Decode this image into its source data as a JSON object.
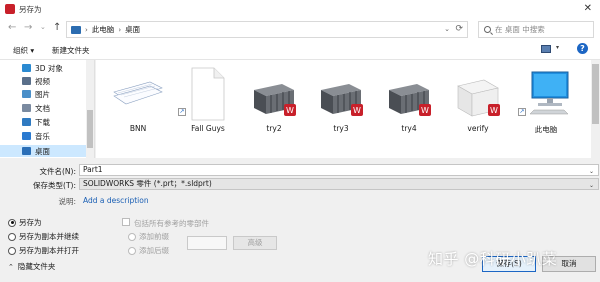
{
  "window": {
    "title": "另存为",
    "close_glyph": "✕"
  },
  "nav": {
    "back": "←",
    "forward": "→",
    "recent": "⌄",
    "up": "↑",
    "breadcrumbs": [
      "此电脑",
      "桌面"
    ],
    "separator": "›",
    "addr_dropdown": "⌄",
    "refresh": "⟳",
    "search_placeholder": "在 桌面 中搜索"
  },
  "toolbar": {
    "organize": "组织 ▾",
    "new_folder": "新建文件夹",
    "view_chevron": "▾",
    "help": "?"
  },
  "sidebar": {
    "items": [
      {
        "label": "3D 对象",
        "icon": "3d-objects-icon",
        "color": "#2b8ad1"
      },
      {
        "label": "视频",
        "icon": "videos-icon",
        "color": "#5a6f8a"
      },
      {
        "label": "图片",
        "icon": "pictures-icon",
        "color": "#4a8fc9"
      },
      {
        "label": "文档",
        "icon": "documents-icon",
        "color": "#7a8aa0"
      },
      {
        "label": "下载",
        "icon": "downloads-icon",
        "color": "#2f7ac1"
      },
      {
        "label": "音乐",
        "icon": "music-icon",
        "color": "#2a7ad0"
      },
      {
        "label": "桌面",
        "icon": "desktop-icon",
        "color": "#2a6fb8"
      }
    ],
    "selected_index": 6
  },
  "files": [
    {
      "label": "BNN",
      "icon": "document-stack-icon"
    },
    {
      "label": "Fall Guys",
      "icon": "blank-file-shortcut-icon"
    },
    {
      "label": "try2",
      "icon": "solidworks-assembly-icon"
    },
    {
      "label": "try3",
      "icon": "solidworks-assembly-icon"
    },
    {
      "label": "try4",
      "icon": "solidworks-assembly-icon"
    },
    {
      "label": "verify",
      "icon": "solidworks-part-icon"
    },
    {
      "label": "此电脑",
      "icon": "this-pc-shortcut-icon"
    }
  ],
  "form": {
    "filename_label": "文件名(N):",
    "filename_value": "Part1",
    "filetype_label": "保存类型(T):",
    "filetype_value": "SOLIDWORKS 零件 (*.prt；*.sldprt)",
    "dropdown_glyph": "⌄",
    "description_label": "说明:",
    "description_link": "Add a description",
    "save_options": [
      "另存为",
      "另存为副本并继续",
      "另存为副本并打开"
    ],
    "selected_option": 0,
    "include_refs": "包括所有参考的零部件",
    "add_prefix": "添加前缀",
    "add_suffix": "添加后缀",
    "advanced": "高级",
    "hide_folders": "隐藏文件夹",
    "hide_chevron": "⌃",
    "save_button": "保存(S)",
    "cancel_button": "取消"
  },
  "watermark": "知乎 @科研小趴菜",
  "colors": {
    "accent": "#1c66c4",
    "selection": "#cce8ff",
    "solidworks_red": "#c8202a"
  }
}
